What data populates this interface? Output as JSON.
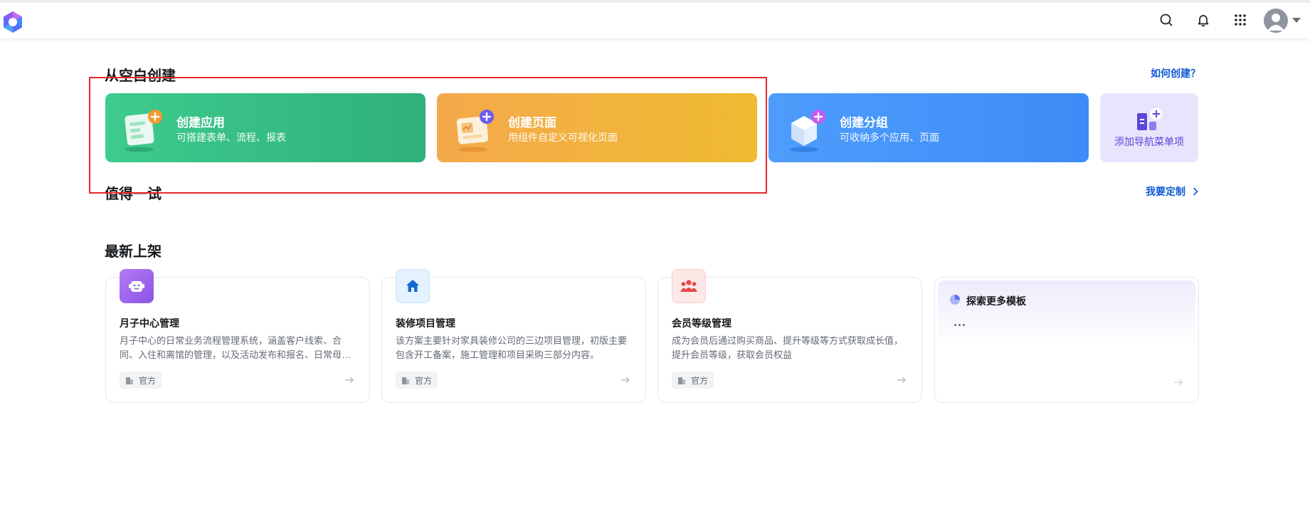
{
  "header": {
    "icons": [
      "search-icon",
      "bell-icon",
      "app-grid-icon",
      "avatar-icon",
      "caret-down-icon"
    ]
  },
  "create_section": {
    "title": "从空白创建",
    "help_link": "如何创建？",
    "cards": [
      {
        "title": "创建应用",
        "desc": "可搭建表单、流程、报表",
        "color_from": "#3ecb8d",
        "color_to": "#2fb07c"
      },
      {
        "title": "创建页面",
        "desc": "用组件自定义可视化页面",
        "color_from": "#f4a94b",
        "color_to": "#efbb32"
      },
      {
        "title": "创建分组",
        "desc": "可收纳多个应用、页面",
        "color_from": "#4e9dfc",
        "color_to": "#3d8cf7"
      }
    ],
    "nav_add_label": "添加导航菜单项"
  },
  "try_section": {
    "title": "值得一试",
    "customize_link": "我要定制"
  },
  "latest_section": {
    "title": "最新上架",
    "templates": [
      {
        "name": "月子中心管理",
        "desc": "月子中心的日常业务流程管理系统，涵盖客户线索、合同、入住和离馆的管理，以及活动发布和报名、日常母婴护理等",
        "badge": "官方",
        "icon": "robot-icon"
      },
      {
        "name": "装修项目管理",
        "desc": "该方案主要针对家具装修公司的三边项目管理，初版主要包含开工备案，施工管理和项目采购三部分内容。",
        "badge": "官方",
        "icon": "house-icon"
      },
      {
        "name": "会员等级管理",
        "desc": "成为会员后通过购买商品、提升等级等方式获取成长值，提升会员等级，获取会员权益",
        "badge": "官方",
        "icon": "members-icon"
      }
    ],
    "explore": {
      "title": "探索更多模板",
      "dots": "..."
    }
  },
  "colors": {
    "accent": "#0e5ad6",
    "highlight_border": "#e8282f"
  }
}
